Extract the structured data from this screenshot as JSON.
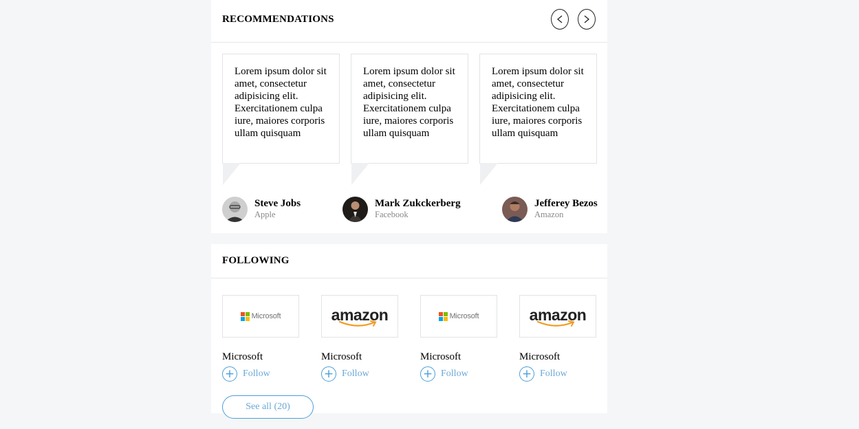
{
  "recommendations": {
    "title": "RECOMMENDATIONS",
    "prev_label": "<",
    "next_label": ">",
    "items": [
      {
        "quote": "Lorem ipsum dolor sit amet, consectetur adipisicing elit. Exercitationem culpa iure, maiores corporis ullam quisquam",
        "name": "Steve Jobs",
        "company": "Apple",
        "avatar_icon": "person-avatar-icon"
      },
      {
        "quote": "Lorem ipsum dolor sit amet, consectetur adipisicing elit. Exercitationem culpa iure, maiores corporis ullam quisquam",
        "name": "Mark Zukckerberg",
        "company": "Facebook",
        "avatar_icon": "person-avatar-icon"
      },
      {
        "quote": "Lorem ipsum dolor sit amet, consectetur adipisicing elit. Exercitationem culpa iure, maiores corporis ullam quisquam",
        "name": "Jefferey Bezos",
        "company": "Amazon",
        "avatar_icon": "person-avatar-icon"
      }
    ]
  },
  "following": {
    "title": "FOLLOWING",
    "companies": [
      {
        "name": "Microsoft",
        "logo": "microsoft-logo",
        "logo_text": "Microsoft",
        "follow_label": "Follow"
      },
      {
        "name": "Microsoft",
        "logo": "amazon-logo",
        "logo_text": "amazon",
        "follow_label": "Follow"
      },
      {
        "name": "Microsoft",
        "logo": "microsoft-logo",
        "logo_text": "Microsoft",
        "follow_label": "Follow"
      },
      {
        "name": "Microsoft",
        "logo": "amazon-logo",
        "logo_text": "amazon",
        "follow_label": "Follow"
      }
    ],
    "see_all_label": "See all (20)"
  },
  "colors": {
    "accent": "#4a9fd8",
    "background": "#f5f6f8",
    "border": "#e2e3e6",
    "muted_text": "#888888"
  }
}
